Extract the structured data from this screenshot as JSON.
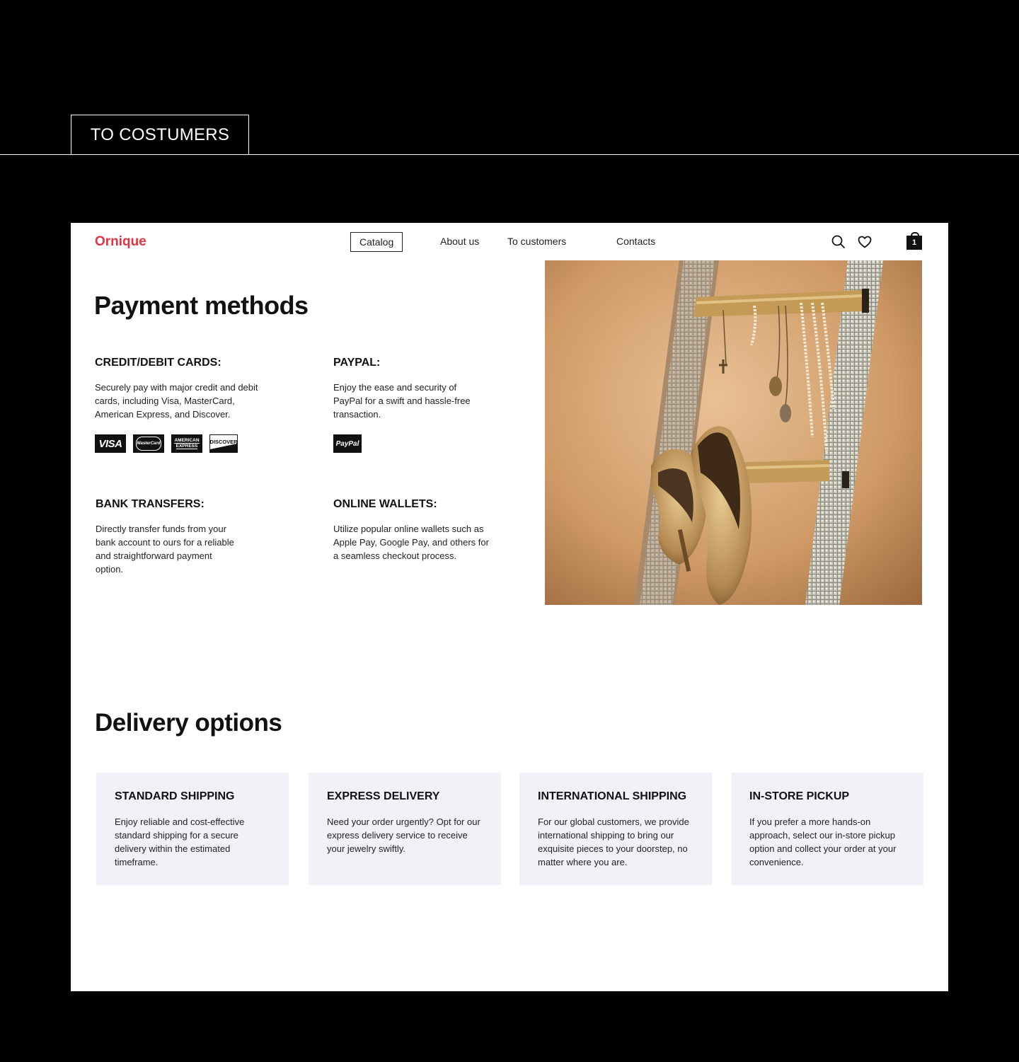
{
  "section": {
    "title": "TO COSTUMERS"
  },
  "header": {
    "logo": "Ornique",
    "nav": [
      {
        "label": "Catalog",
        "active": true
      },
      {
        "label": "About us"
      },
      {
        "label": "To customers"
      },
      {
        "label": "Contacts"
      }
    ],
    "icons": [
      "search-icon",
      "heart-icon",
      "cart-icon"
    ],
    "cart_count": "1"
  },
  "payment": {
    "title": "Payment methods",
    "methods": [
      {
        "title": "CREDIT/DEBIT CARDS:",
        "text": "Securely pay with major credit and debit cards, including Visa, MasterCard, American Express, and Discover."
      },
      {
        "title": "PAYPAL:",
        "text": "Enjoy the ease and security of PayPal for a swift and hassle-free transaction."
      },
      {
        "title": "BANK TRANSFERS:",
        "text": "Directly transfer funds from your bank account to ours for a reliable and straightforward payment option."
      },
      {
        "title": "ONLINE WALLETS:",
        "text": "Utilize popular online wallets such as Apple Pay, Google Pay, and others for a seamless checkout process."
      }
    ],
    "card_logos": {
      "visa": "VISA",
      "mastercard": "MasterCard",
      "amex_line1": "AMERICAN",
      "amex_line2": "EXPRESS",
      "discover": "DISCOVER",
      "paypal": "PayPal"
    }
  },
  "delivery": {
    "title": "Delivery options",
    "options": [
      {
        "title": "STANDARD SHIPPING",
        "text": "Enjoy reliable and cost-effective standard shipping for a secure delivery within the estimated timeframe."
      },
      {
        "title": "EXPRESS DELIVERY",
        "text": "Need your order urgently? Opt for our express delivery service to receive your jewelry swiftly."
      },
      {
        "title": "INTERNATIONAL SHIPPING",
        "text": "For our global customers, we provide international shipping to bring our exquisite pieces to your doorstep, no matter where you are."
      },
      {
        "title": "IN-STORE PICKUP",
        "text": "If you prefer a more hands-on approach, select our in-store pickup option and collect your order at your convenience."
      }
    ]
  },
  "colors": {
    "brand": "#e53340",
    "card_bg": "#f1f2f7",
    "page_bg": "#000000"
  }
}
